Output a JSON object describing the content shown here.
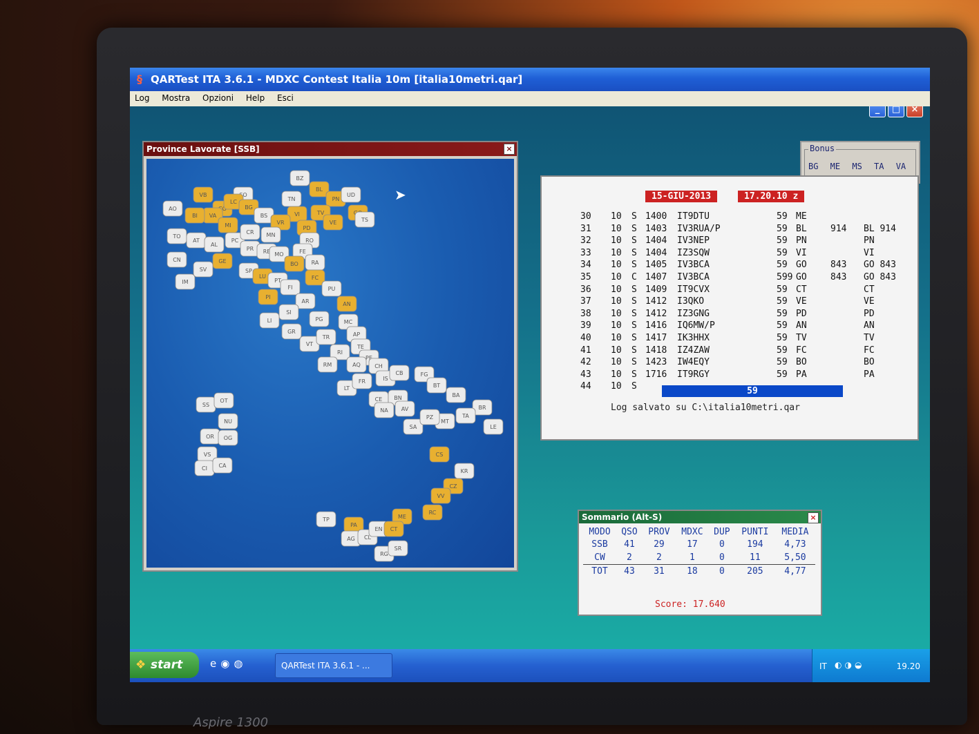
{
  "window": {
    "title": "QARTest ITA 3.6.1 - MDXC Contest Italia 10m  [italia10metri.qar]",
    "controls": [
      "_",
      "□",
      "×"
    ]
  },
  "menu": [
    "Log",
    "Mostra",
    "Opzioni",
    "Help",
    "Esci"
  ],
  "map_window": {
    "title": "Province Lavorate [SSB]",
    "close": "×",
    "worked_color": "#e8b030",
    "unworked_color": "#ececec",
    "provinces": [
      {
        "code": "BZ",
        "worked": false
      },
      {
        "code": "SO",
        "worked": false
      },
      {
        "code": "VB",
        "worked": true
      },
      {
        "code": "CO",
        "worked": true
      },
      {
        "code": "LC",
        "worked": true
      },
      {
        "code": "VA",
        "worked": true
      },
      {
        "code": "BG",
        "worked": true
      },
      {
        "code": "BL",
        "worked": true
      },
      {
        "code": "PN",
        "worked": true
      },
      {
        "code": "UD",
        "worked": false
      },
      {
        "code": "TN",
        "worked": false
      },
      {
        "code": "BS",
        "worked": false
      },
      {
        "code": "MI",
        "worked": true
      },
      {
        "code": "BI",
        "worked": true
      },
      {
        "code": "VI",
        "worked": true
      },
      {
        "code": "TV",
        "worked": true
      },
      {
        "code": "VE",
        "worked": true
      },
      {
        "code": "VR",
        "worked": true
      },
      {
        "code": "PD",
        "worked": true
      },
      {
        "code": "GO",
        "worked": true
      },
      {
        "code": "TS",
        "worked": false
      },
      {
        "code": "AO",
        "worked": false
      },
      {
        "code": "TO",
        "worked": false
      },
      {
        "code": "CN",
        "worked": false
      },
      {
        "code": "AT",
        "worked": false
      },
      {
        "code": "AL",
        "worked": false
      },
      {
        "code": "PC",
        "worked": false
      },
      {
        "code": "CR",
        "worked": false
      },
      {
        "code": "MN",
        "worked": false
      },
      {
        "code": "RO",
        "worked": false
      },
      {
        "code": "PR",
        "worked": false
      },
      {
        "code": "RE",
        "worked": false
      },
      {
        "code": "MO",
        "worked": false
      },
      {
        "code": "FE",
        "worked": false
      },
      {
        "code": "GE",
        "worked": true
      },
      {
        "code": "SV",
        "worked": false
      },
      {
        "code": "IM",
        "worked": false
      },
      {
        "code": "SP",
        "worked": false
      },
      {
        "code": "BO",
        "worked": true
      },
      {
        "code": "RA",
        "worked": false
      },
      {
        "code": "FC",
        "worked": true
      },
      {
        "code": "LU",
        "worked": true
      },
      {
        "code": "PT",
        "worked": false
      },
      {
        "code": "FI",
        "worked": false
      },
      {
        "code": "PI",
        "worked": true
      },
      {
        "code": "PU",
        "worked": false
      },
      {
        "code": "AN",
        "worked": true
      },
      {
        "code": "AR",
        "worked": false
      },
      {
        "code": "SI",
        "worked": false
      },
      {
        "code": "LI",
        "worked": false
      },
      {
        "code": "GR",
        "worked": false
      },
      {
        "code": "PG",
        "worked": false
      },
      {
        "code": "MC",
        "worked": false
      },
      {
        "code": "AP",
        "worked": false
      },
      {
        "code": "TE",
        "worked": false
      },
      {
        "code": "VT",
        "worked": false
      },
      {
        "code": "TR",
        "worked": false
      },
      {
        "code": "RI",
        "worked": false
      },
      {
        "code": "PE",
        "worked": false
      },
      {
        "code": "CH",
        "worked": false
      },
      {
        "code": "RM",
        "worked": false
      },
      {
        "code": "AQ",
        "worked": false
      },
      {
        "code": "LT",
        "worked": false
      },
      {
        "code": "FR",
        "worked": false
      },
      {
        "code": "IS",
        "worked": false
      },
      {
        "code": "CB",
        "worked": false
      },
      {
        "code": "FG",
        "worked": false
      },
      {
        "code": "CE",
        "worked": false
      },
      {
        "code": "BN",
        "worked": false
      },
      {
        "code": "NA",
        "worked": false
      },
      {
        "code": "AV",
        "worked": false
      },
      {
        "code": "SA",
        "worked": false
      },
      {
        "code": "BT",
        "worked": false
      },
      {
        "code": "BA",
        "worked": false
      },
      {
        "code": "BR",
        "worked": false
      },
      {
        "code": "TA",
        "worked": false
      },
      {
        "code": "LE",
        "worked": false
      },
      {
        "code": "MT",
        "worked": false
      },
      {
        "code": "PZ",
        "worked": false
      },
      {
        "code": "CS",
        "worked": true
      },
      {
        "code": "KR",
        "worked": false
      },
      {
        "code": "CZ",
        "worked": true
      },
      {
        "code": "VV",
        "worked": true
      },
      {
        "code": "RC",
        "worked": true
      },
      {
        "code": "TP",
        "worked": false
      },
      {
        "code": "PA",
        "worked": true
      },
      {
        "code": "ME",
        "worked": true
      },
      {
        "code": "AG",
        "worked": false
      },
      {
        "code": "CL",
        "worked": false
      },
      {
        "code": "EN",
        "worked": false
      },
      {
        "code": "CT",
        "worked": true
      },
      {
        "code": "RG",
        "worked": false
      },
      {
        "code": "SR",
        "worked": false
      },
      {
        "code": "SS",
        "worked": false
      },
      {
        "code": "OT",
        "worked": false
      },
      {
        "code": "NU",
        "worked": false
      },
      {
        "code": "OR",
        "worked": false
      },
      {
        "code": "OG",
        "worked": false
      },
      {
        "code": "VS",
        "worked": false
      },
      {
        "code": "CI",
        "worked": false
      },
      {
        "code": "CA",
        "worked": false
      }
    ]
  },
  "log": {
    "date": "15-GIU-2013",
    "time": "17.20.10 z",
    "rows": [
      {
        "n": "30",
        "band": "10",
        "mode": "S",
        "time": "1400",
        "call": "IT9DTU",
        "rst": "59",
        "prov": "ME",
        "m1": "",
        "m2": "",
        "mult": ""
      },
      {
        "n": "31",
        "band": "10",
        "mode": "S",
        "time": "1403",
        "call": "IV3RUA/P",
        "rst": "59",
        "prov": "BL",
        "m1": "914",
        "m2": "BL 914",
        "mult": ""
      },
      {
        "n": "32",
        "band": "10",
        "mode": "S",
        "time": "1404",
        "call": "IV3NEP",
        "rst": "59",
        "prov": "PN",
        "m1": "",
        "m2": "PN",
        "mult": ""
      },
      {
        "n": "33",
        "band": "10",
        "mode": "S",
        "time": "1404",
        "call": "IZ3SQW",
        "rst": "59",
        "prov": "VI",
        "m1": "",
        "m2": "VI",
        "mult": ""
      },
      {
        "n": "34",
        "band": "10",
        "mode": "S",
        "time": "1405",
        "call": "IV3BCA",
        "rst": "59",
        "prov": "GO",
        "m1": "843",
        "m2": "GO 843",
        "mult": ""
      },
      {
        "n": "35",
        "band": "10",
        "mode": "C",
        "time": "1407",
        "call": "IV3BCA",
        "rst": "599",
        "prov": "GO",
        "m1": "843",
        "m2": "GO 843",
        "mult": ""
      },
      {
        "n": "36",
        "band": "10",
        "mode": "S",
        "time": "1409",
        "call": "IT9CVX",
        "rst": "59",
        "prov": "CT",
        "m1": "",
        "m2": "CT",
        "mult": ""
      },
      {
        "n": "37",
        "band": "10",
        "mode": "S",
        "time": "1412",
        "call": "I3QKO",
        "rst": "59",
        "prov": "VE",
        "m1": "",
        "m2": "VE",
        "mult": ""
      },
      {
        "n": "38",
        "band": "10",
        "mode": "S",
        "time": "1412",
        "call": "IZ3GNG",
        "rst": "59",
        "prov": "PD",
        "m1": "",
        "m2": "PD",
        "mult": ""
      },
      {
        "n": "39",
        "band": "10",
        "mode": "S",
        "time": "1416",
        "call": "IQ6MW/P",
        "rst": "59",
        "prov": "AN",
        "m1": "",
        "m2": "AN",
        "mult": ""
      },
      {
        "n": "40",
        "band": "10",
        "mode": "S",
        "time": "1417",
        "call": "IK3HHX",
        "rst": "59",
        "prov": "TV",
        "m1": "",
        "m2": "TV",
        "mult": ""
      },
      {
        "n": "41",
        "band": "10",
        "mode": "S",
        "time": "1418",
        "call": "IZ4ZAW",
        "rst": "59",
        "prov": "FC",
        "m1": "",
        "m2": "FC",
        "mult": ""
      },
      {
        "n": "42",
        "band": "10",
        "mode": "S",
        "time": "1423",
        "call": "IW4EQY",
        "rst": "59",
        "prov": "BO",
        "m1": "",
        "m2": "BO",
        "mult": ""
      },
      {
        "n": "43",
        "band": "10",
        "mode": "S",
        "time": "1716",
        "call": "IT9RGY",
        "rst": "59",
        "prov": "PA",
        "m1": "",
        "m2": "PA",
        "mult": ""
      },
      {
        "n": "44",
        "band": "10",
        "mode": "S",
        "time": "",
        "call": "",
        "rst": "",
        "prov": "",
        "m1": "",
        "m2": "",
        "mult": ""
      }
    ],
    "current_rst": "59",
    "status": "Log salvato su C:\\italia10metri.qar"
  },
  "bonus": {
    "label": "Bonus",
    "items": "BG ME MS TA VA"
  },
  "summary": {
    "title": "Sommario (Alt-S)",
    "close": "×",
    "headers": [
      "MODO",
      "QSO",
      "PROV",
      "MDXC",
      "DUP",
      "PUNTI",
      "MEDIA"
    ],
    "rows": [
      [
        "SSB",
        "41",
        "29",
        "17",
        "0",
        "194",
        "4,73"
      ],
      [
        "CW",
        "2",
        "2",
        "1",
        "0",
        "11",
        "5,50"
      ],
      [
        "TOT",
        "43",
        "31",
        "18",
        "0",
        "205",
        "4,77"
      ]
    ],
    "score": "Score: 17.640"
  },
  "taskbar": {
    "start": "start",
    "task": "QARTest ITA 3.6.1 - ...",
    "lang": "IT",
    "clock": "19.20"
  },
  "laptop_brand": "Aspire 1300"
}
